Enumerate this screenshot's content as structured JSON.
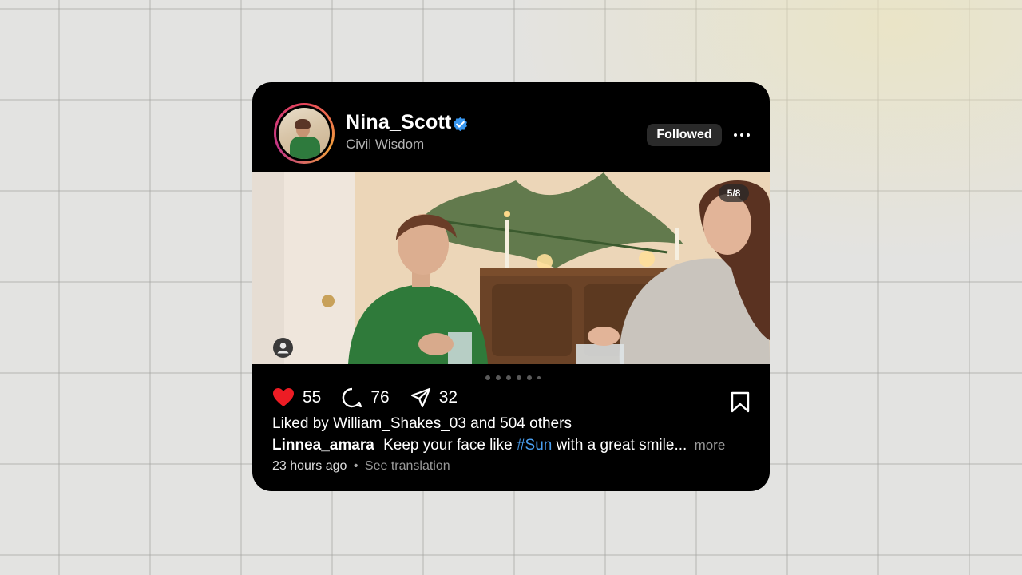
{
  "post": {
    "user": {
      "name": "Nina_Scott",
      "subtitle": "Civil Wisdom",
      "verified": true,
      "verified_color": "#3897f0"
    },
    "follow_label": "Followed",
    "slide_counter": "5/8",
    "dots_count": 6,
    "likes_count": "55",
    "comments_count": "76",
    "shares_count": "32",
    "like_color": "#ed1c24",
    "liked_by_text": "Liked by William_Shakes_03 and 504 others",
    "caption": {
      "author": "Linnea_amara",
      "text_before": "Keep your face like",
      "hashtag": "#Sun",
      "text_after": "with a great smile...",
      "more_label": "more"
    },
    "time_ago": "23 hours ago",
    "separator": "•",
    "translate_label": "See translation"
  },
  "icons": {
    "more": "more-horizontal-icon",
    "like": "heart-icon",
    "comment": "comment-icon",
    "share": "send-icon",
    "save": "bookmark-icon",
    "tag": "user-tag-icon"
  }
}
